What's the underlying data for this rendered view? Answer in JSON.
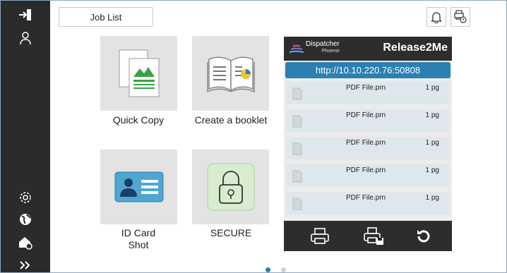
{
  "top_bar": {
    "job_list_label": "Job List",
    "notification_icon": "bell-icon",
    "job_status_icon": "job-status-icon"
  },
  "sidebar": {
    "icons": [
      "login-icon",
      "user-icon",
      "settings-gear-icon",
      "globe-icon",
      "home-settings-icon",
      "expand-chevrons-icon"
    ]
  },
  "tiles": [
    {
      "label": "Quick Copy",
      "icon": "copy-documents-icon"
    },
    {
      "label": "Create a booklet",
      "icon": "booklet-icon"
    },
    {
      "label": "ID Card\nShot",
      "label_line1": "ID Card",
      "label_line2": "Shot",
      "icon": "id-card-icon"
    },
    {
      "label": "SECURE",
      "icon": "padlock-icon"
    }
  ],
  "release_panel": {
    "brand": "Dispatcher",
    "brand_sub": "Phoenix",
    "title": "Release2Me",
    "url": "http://10.10.220.76:50808",
    "jobs": [
      {
        "name": "PDF File.prn",
        "pages": "1 pg"
      },
      {
        "name": "PDF File.prn",
        "pages": "1 pg"
      },
      {
        "name": "PDF File.prn",
        "pages": "1 pg"
      },
      {
        "name": "PDF File.prn",
        "pages": "1 pg"
      },
      {
        "name": "PDF File.prn",
        "pages": "1 pg"
      }
    ],
    "footer_icons": [
      "print-icon",
      "print-and-save-icon",
      "refresh-icon"
    ]
  },
  "pagination": {
    "total_pages": 2,
    "current_page": 1
  },
  "colors": {
    "accent": "#2a7fb3",
    "sidebar": "#2b2b2b",
    "row": "#dde7ec"
  }
}
